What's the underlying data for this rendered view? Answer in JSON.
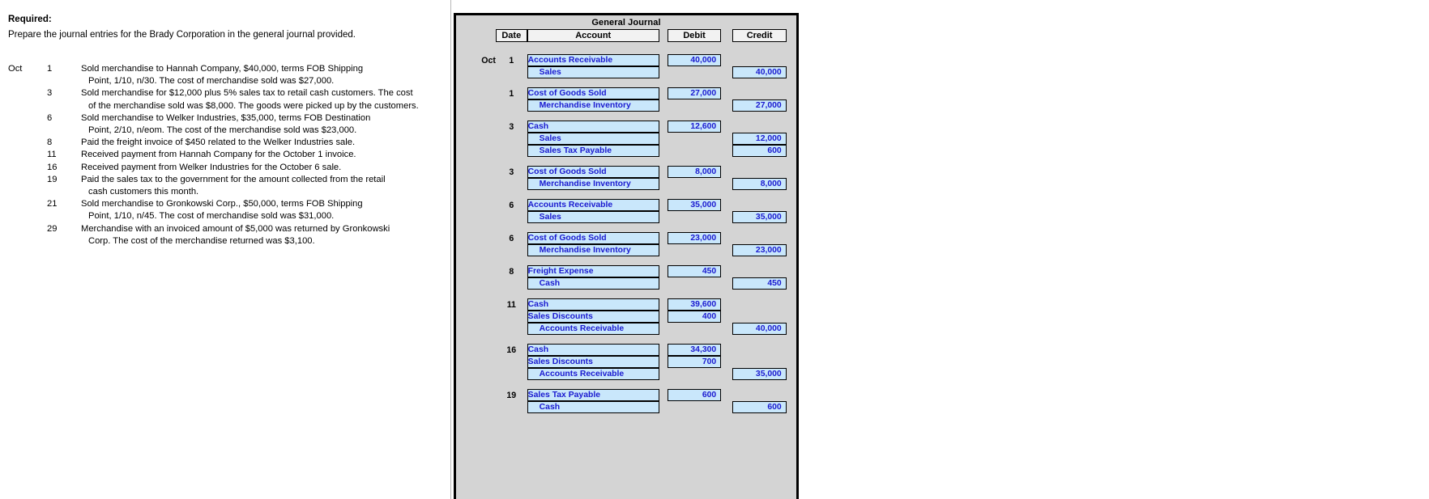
{
  "problem": {
    "required_label": "Required:",
    "required_text": "Prepare the journal entries for the Brady Corporation in the general journal provided.",
    "month": "Oct",
    "transactions": [
      {
        "day": "1",
        "line1": "Sold merchandise to Hannah Company, $40,000, terms FOB Shipping",
        "line2": "Point, 1/10, n/30. The cost of merchandise sold was $27,000."
      },
      {
        "day": "3",
        "line1": "Sold merchandise for $12,000 plus 5% sales tax to retail cash customers. The cost",
        "line2": "of the merchandise sold was $8,000. The goods were picked up by the customers."
      },
      {
        "day": "6",
        "line1": "Sold merchandise to Welker Industries, $35,000, terms FOB Destination",
        "line2": "Point, 2/10, n/eom. The cost of the merchandise sold was $23,000."
      },
      {
        "day": "8",
        "line1": "Paid the freight invoice of $450 related to the Welker Industries sale.",
        "line2": ""
      },
      {
        "day": "11",
        "line1": "Received payment from Hannah Company for the October 1 invoice.",
        "line2": ""
      },
      {
        "day": "16",
        "line1": "Received payment from Welker Industries for the October 6 sale.",
        "line2": ""
      },
      {
        "day": "19",
        "line1": "Paid the sales tax to the government for the amount collected from the retail",
        "line2": "cash customers this month."
      },
      {
        "day": "21",
        "line1": "Sold merchandise to Gronkowski Corp., $50,000, terms FOB Shipping",
        "line2": "Point, 1/10, n/45. The cost of merchandise sold was $31,000."
      },
      {
        "day": "29",
        "line1": "Merchandise with an invoiced amount of $5,000 was returned by Gronkowski",
        "line2": "Corp. The cost of the merchandise returned was $3,100."
      }
    ]
  },
  "journal": {
    "title": "General Journal",
    "headers": {
      "date": "Date",
      "account": "Account",
      "debit": "Debit",
      "credit": "Credit"
    },
    "month": "Oct",
    "entries": [
      {
        "date": "1",
        "show_month": true,
        "lines": [
          {
            "account": "Accounts Receivable",
            "indent": false,
            "debit": "40,000",
            "credit": ""
          },
          {
            "account": "Sales",
            "indent": true,
            "debit": "",
            "credit": "40,000"
          }
        ]
      },
      {
        "date": "1",
        "show_month": false,
        "lines": [
          {
            "account": "Cost of Goods Sold",
            "indent": false,
            "debit": "27,000",
            "credit": ""
          },
          {
            "account": "Merchandise Inventory",
            "indent": true,
            "debit": "",
            "credit": "27,000"
          }
        ]
      },
      {
        "date": "3",
        "show_month": false,
        "lines": [
          {
            "account": "Cash",
            "indent": false,
            "debit": "12,600",
            "credit": ""
          },
          {
            "account": "Sales",
            "indent": true,
            "debit": "",
            "credit": "12,000"
          },
          {
            "account": "Sales Tax Payable",
            "indent": true,
            "debit": "",
            "credit": "600"
          }
        ]
      },
      {
        "date": "3",
        "show_month": false,
        "lines": [
          {
            "account": "Cost of Goods Sold",
            "indent": false,
            "debit": "8,000",
            "credit": ""
          },
          {
            "account": "Merchandise Inventory",
            "indent": true,
            "debit": "",
            "credit": "8,000"
          }
        ]
      },
      {
        "date": "6",
        "show_month": false,
        "lines": [
          {
            "account": "Accounts Receivable",
            "indent": false,
            "debit": "35,000",
            "credit": ""
          },
          {
            "account": "Sales",
            "indent": true,
            "debit": "",
            "credit": "35,000"
          }
        ]
      },
      {
        "date": "6",
        "show_month": false,
        "lines": [
          {
            "account": "Cost of Goods Sold",
            "indent": false,
            "debit": "23,000",
            "credit": ""
          },
          {
            "account": "Merchandise Inventory",
            "indent": true,
            "debit": "",
            "credit": "23,000"
          }
        ]
      },
      {
        "date": "8",
        "show_month": false,
        "lines": [
          {
            "account": "Freight Expense",
            "indent": false,
            "debit": "450",
            "credit": ""
          },
          {
            "account": "Cash",
            "indent": true,
            "debit": "",
            "credit": "450"
          }
        ]
      },
      {
        "date": "11",
        "show_month": false,
        "lines": [
          {
            "account": "Cash",
            "indent": false,
            "debit": "39,600",
            "credit": ""
          },
          {
            "account": "Sales Discounts",
            "indent": false,
            "debit": "400",
            "credit": ""
          },
          {
            "account": "Accounts Receivable",
            "indent": true,
            "debit": "",
            "credit": "40,000"
          }
        ]
      },
      {
        "date": "16",
        "show_month": false,
        "lines": [
          {
            "account": "Cash",
            "indent": false,
            "debit": "34,300",
            "credit": ""
          },
          {
            "account": "Sales Discounts",
            "indent": false,
            "debit": "700",
            "credit": ""
          },
          {
            "account": "Accounts Receivable",
            "indent": true,
            "debit": "",
            "credit": "35,000"
          }
        ]
      },
      {
        "date": "19",
        "show_month": false,
        "lines": [
          {
            "account": "Sales Tax Payable",
            "indent": false,
            "debit": "600",
            "credit": ""
          },
          {
            "account": "Cash",
            "indent": true,
            "debit": "",
            "credit": "600"
          }
        ]
      }
    ]
  }
}
